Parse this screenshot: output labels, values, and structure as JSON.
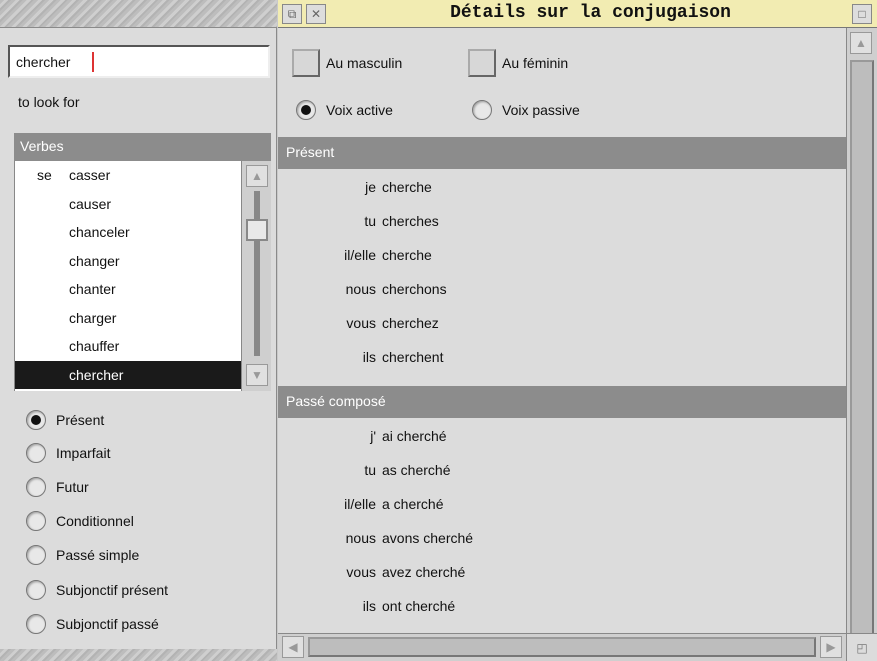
{
  "search": {
    "value": "chercher"
  },
  "translation": "to look for",
  "verbs": {
    "header": "Verbes",
    "items": [
      {
        "prefix": "se",
        "verb": "casser"
      },
      {
        "prefix": "",
        "verb": "causer"
      },
      {
        "prefix": "",
        "verb": "chanceler"
      },
      {
        "prefix": "",
        "verb": "changer"
      },
      {
        "prefix": "",
        "verb": "chanter"
      },
      {
        "prefix": "",
        "verb": "charger"
      },
      {
        "prefix": "",
        "verb": "chauffer"
      },
      {
        "prefix": "",
        "verb": "chercher"
      }
    ],
    "selected": "chercher"
  },
  "tenses": {
    "options": [
      "Présent",
      "Imparfait",
      "Futur",
      "Conditionnel",
      "Passé simple",
      "Subjonctif présent",
      "Subjonctif passé"
    ],
    "selected": "Présent"
  },
  "window": {
    "title": "Détails sur la conjugaison"
  },
  "gender": {
    "masculin": "Au masculin",
    "feminin": "Au féminin"
  },
  "voice": {
    "active": "Voix active",
    "passive": "Voix passive",
    "selected": "active"
  },
  "sections": [
    {
      "title": "Présent",
      "rows": [
        {
          "pronoun": "je",
          "form": "cherche"
        },
        {
          "pronoun": "tu",
          "form": "cherches"
        },
        {
          "pronoun": "il/elle",
          "form": "cherche"
        },
        {
          "pronoun": "nous",
          "form": "cherchons"
        },
        {
          "pronoun": "vous",
          "form": "cherchez"
        },
        {
          "pronoun": "ils",
          "form": "cherchent"
        }
      ]
    },
    {
      "title": "Passé composé",
      "rows": [
        {
          "pronoun": "j'",
          "form": "ai cherché"
        },
        {
          "pronoun": "tu",
          "form": "as cherché"
        },
        {
          "pronoun": "il/elle",
          "form": "a cherché"
        },
        {
          "pronoun": "nous",
          "form": "avons cherché"
        },
        {
          "pronoun": "vous",
          "form": "avez cherché"
        },
        {
          "pronoun": "ils",
          "form": "ont cherché"
        }
      ]
    }
  ],
  "icons": {
    "back": "back-icon",
    "close": "close-icon",
    "toggle_size": "toggle-size-icon",
    "arrow_up": "arrow-up-icon",
    "arrow_down": "arrow-down-icon",
    "arrow_left": "arrow-left-icon",
    "arrow_right": "arrow-right-icon",
    "resize": "resize-icon"
  }
}
